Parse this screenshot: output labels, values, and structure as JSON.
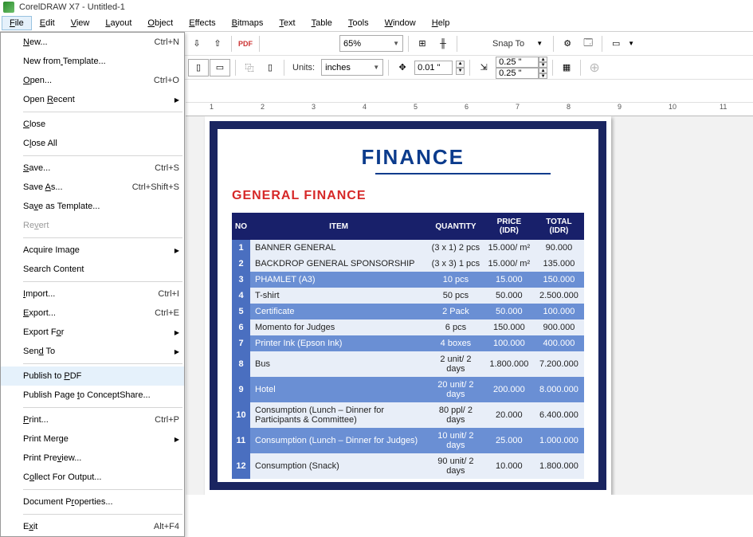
{
  "title": "CorelDRAW X7 - Untitled-1",
  "menubar": [
    "File",
    "Edit",
    "View",
    "Layout",
    "Object",
    "Effects",
    "Bitmaps",
    "Text",
    "Table",
    "Tools",
    "Window",
    "Help"
  ],
  "toolbar1": {
    "zoom": "65%",
    "snap_label": "Snap To"
  },
  "toolbar2": {
    "units_label": "Units:",
    "units_value": "inches",
    "nudge": "0.01 \"",
    "dup_x": "0.25 \"",
    "dup_y": "0.25 \""
  },
  "filemenu": [
    {
      "label": "New...",
      "sc": "Ctrl+N",
      "u": 0
    },
    {
      "label": "New from Template...",
      "u": 8
    },
    {
      "label": "Open...",
      "sc": "Ctrl+O",
      "u": 0
    },
    {
      "label": "Open Recent",
      "sub": true,
      "u": 5
    },
    {
      "sep": true
    },
    {
      "label": "Close",
      "u": 0
    },
    {
      "label": "Close All",
      "u": 1
    },
    {
      "sep": true
    },
    {
      "label": "Save...",
      "sc": "Ctrl+S",
      "u": 0
    },
    {
      "label": "Save As...",
      "sc": "Ctrl+Shift+S",
      "u": 5
    },
    {
      "label": "Save as Template...",
      "u": 2
    },
    {
      "label": "Revert",
      "u": 2,
      "disabled": true
    },
    {
      "sep": true
    },
    {
      "label": "Acquire Image",
      "sub": true
    },
    {
      "label": "Search Content"
    },
    {
      "sep": true
    },
    {
      "label": "Import...",
      "sc": "Ctrl+I",
      "u": 0
    },
    {
      "label": "Export...",
      "sc": "Ctrl+E",
      "u": 0
    },
    {
      "label": "Export For",
      "sub": true,
      "u": 8
    },
    {
      "label": "Send To",
      "sub": true,
      "u": 3
    },
    {
      "sep": true
    },
    {
      "label": "Publish to PDF",
      "u": 11,
      "hover": true
    },
    {
      "label": "Publish Page to ConceptShare...",
      "u": 13
    },
    {
      "sep": true
    },
    {
      "label": "Print...",
      "sc": "Ctrl+P",
      "u": 0
    },
    {
      "label": "Print Merge",
      "sub": true
    },
    {
      "label": "Print Preview...",
      "u": 9
    },
    {
      "label": "Collect For Output...",
      "u": 1
    },
    {
      "sep": true
    },
    {
      "label": "Document Properties...",
      "u": 10
    },
    {
      "sep": true
    },
    {
      "label": "Exit",
      "sc": "Alt+F4",
      "u": 1
    }
  ],
  "ruler_numbers": [
    "1",
    "2",
    "3",
    "4",
    "5",
    "6",
    "7",
    "8",
    "9",
    "10",
    "11"
  ],
  "doc": {
    "title": "FINANCE",
    "subtitle": "GENERAL FINANCE",
    "headers": [
      "NO",
      "ITEM",
      "QUANTITY",
      "PRICE (IDR)",
      "TOTAL (IDR)"
    ],
    "rows": [
      {
        "no": "1",
        "item": "BANNER GENERAL",
        "qty": "(3 x 1) 2 pcs",
        "price": "15.000/ m²",
        "total": "90.000"
      },
      {
        "no": "2",
        "item": "BACKDROP GENERAL SPONSORSHIP",
        "qty": "(3 x 3) 1 pcs",
        "price": "15.000/ m²",
        "total": "135.000"
      },
      {
        "no": "3",
        "item": "PHAMLET (A3)",
        "qty": "10 pcs",
        "price": "15.000",
        "total": "150.000"
      },
      {
        "no": "4",
        "item": "T-shirt",
        "qty": "50 pcs",
        "price": "50.000",
        "total": "2.500.000"
      },
      {
        "no": "5",
        "item": "Certificate",
        "qty": "2 Pack",
        "price": "50.000",
        "total": "100.000"
      },
      {
        "no": "6",
        "item": "Momento for Judges",
        "qty": "6 pcs",
        "price": "150.000",
        "total": "900.000"
      },
      {
        "no": "7",
        "item": "Printer Ink (Epson Ink)",
        "qty": "4 boxes",
        "price": "100.000",
        "total": "400.000"
      },
      {
        "no": "8",
        "item": "Bus",
        "qty": "2 unit/ 2 days",
        "price": "1.800.000",
        "total": "7.200.000"
      },
      {
        "no": "9",
        "item": "Hotel",
        "qty": "20 unit/ 2 days",
        "price": "200.000",
        "total": "8.000.000"
      },
      {
        "no": "10",
        "item": "Consumption (Lunch – Dinner for Participants & Committee)",
        "qty": "80 ppl/ 2 days",
        "price": "20.000",
        "total": "6.400.000"
      },
      {
        "no": "11",
        "item": "Consumption (Lunch – Dinner for Judges)",
        "qty": "10 unit/ 2 days",
        "price": "25.000",
        "total": "1.000.000"
      },
      {
        "no": "12",
        "item": "Consumption (Snack)",
        "qty": "90 unit/ 2 days",
        "price": "10.000",
        "total": "1.800.000"
      }
    ]
  }
}
